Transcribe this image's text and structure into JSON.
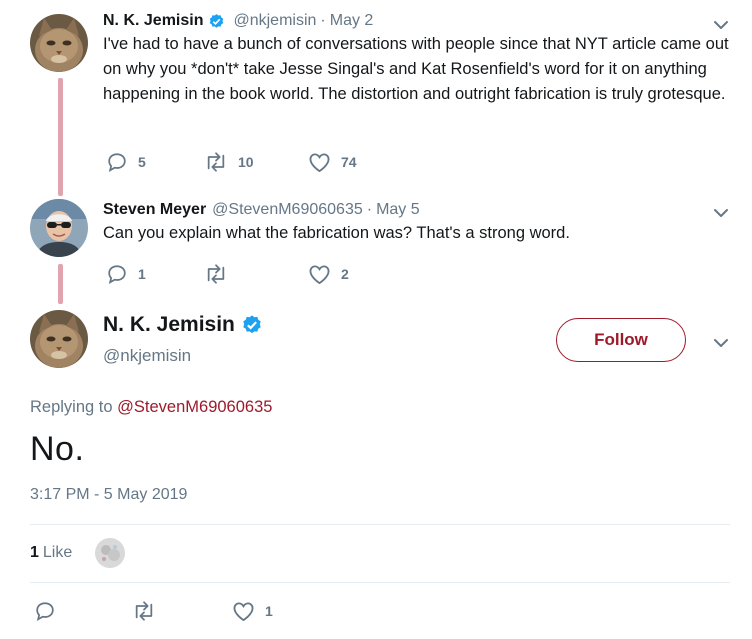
{
  "tweets": [
    {
      "name": "N. K. Jemisin",
      "verified": true,
      "handle": "@nkjemisin",
      "date": "May 2",
      "text": "I've had to have a bunch of conversations with people since that NYT article came out on why you *don't* take Jesse Singal's and Kat Rosenfield's word for it on anything happening in the book world. The distortion and outright fabrication is truly grotesque.",
      "replies": "5",
      "retweets": "10",
      "likes": "74",
      "avatar_icon": "cat-avatar"
    },
    {
      "name": "Steven Meyer",
      "verified": false,
      "handle": "@StevenM69060635",
      "date": "May 5",
      "text": "Can you explain what the fabrication was? That's a strong word.",
      "replies": "1",
      "retweets": "",
      "likes": "2",
      "avatar_icon": "man-sunglasses-avatar"
    }
  ],
  "separator": "·",
  "main_tweet": {
    "name": "N. K. Jemisin",
    "verified": true,
    "handle": "@nkjemisin",
    "follow_label": "Follow",
    "replying_prefix": "Replying to",
    "replying_handle": "@StevenM69060635",
    "text": "No.",
    "timestamp": "3:17 PM - 5 May 2019",
    "like_count": "1",
    "like_label": "Like",
    "replies": "",
    "retweets": "",
    "likes": "1"
  },
  "colors": {
    "accent": "#9e1a2a",
    "verified": "#1da1f2",
    "muted": "#657786",
    "thread_line": "#e1a3ad",
    "divider": "#e6ecf0"
  }
}
